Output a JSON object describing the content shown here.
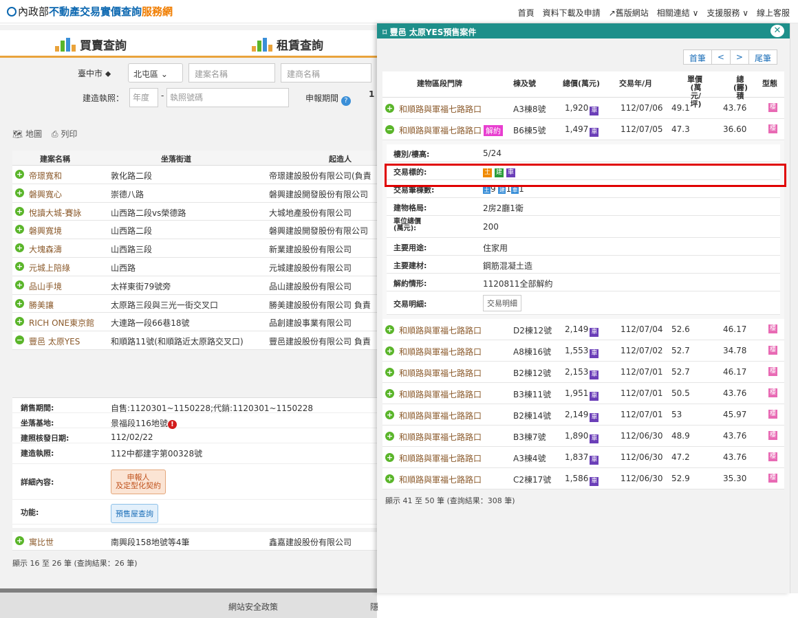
{
  "header": {
    "gov": "內政部",
    "title": "不動產交易實價查詢",
    "service": "服務網",
    "nav": [
      "首頁",
      "資料下載及申請",
      "舊版網站",
      "相關連結 ∨",
      "支援服務 ∨",
      "線上客服"
    ]
  },
  "tabs": {
    "buy": "買賣查詢",
    "rent": "租賃查詢"
  },
  "form": {
    "city": "臺中市 ⬥",
    "district": "北屯區",
    "district_caret": "⌄",
    "case_ph": "建案名稱",
    "builder_ph": "建商名稱",
    "permit_label": "建造執照：",
    "year_ph": "年度",
    "dash": "-",
    "permit_ph": "執照號碼",
    "period_label": "申報期間",
    "period_value": "1"
  },
  "tools": {
    "map": "地圖",
    "print": "列印"
  },
  "left_table": {
    "headers": [
      "建案名稱",
      "坐落街道",
      "起造人"
    ],
    "rows": [
      {
        "name": "帝璟寬和",
        "street": "敦化路二段",
        "owner": "帝璟建設股份有限公司(負責"
      },
      {
        "name": "磐興寬心",
        "street": "崇德八路",
        "owner": "磐興建設開發股份有限公司"
      },
      {
        "name": "悅讀大城-賽詠",
        "street": "山西路二段vs榮德路",
        "owner": "大城地產股份有限公司"
      },
      {
        "name": "磐興寬境",
        "street": "山西路二段",
        "owner": "磐興建設開發股份有限公司"
      },
      {
        "name": "大塊森濤",
        "street": "山西路三段",
        "owner": "新業建設股份有限公司"
      },
      {
        "name": "元城上陪綠",
        "street": "山西路",
        "owner": "元城建設股份有限公司"
      },
      {
        "name": "品山手境",
        "street": "太祥東街79號旁",
        "owner": "品山建設股份有限公司"
      },
      {
        "name": "勝美讓",
        "street": "太原路三段與三光一街交叉口",
        "owner": "勝美建設股份有限公司 負責"
      },
      {
        "name": "RICH ONE東京館",
        "street": "大連路一段66巷18號",
        "owner": "品創建設事業有限公司"
      },
      {
        "name": "豐邑 太原YES",
        "street": "和順路11號(和順路近太原路交叉口)",
        "owner": "豐邑建設股份有限公司 負責"
      }
    ],
    "after_row": {
      "name": "寓比世",
      "street": "南興段158地號等4筆",
      "owner": "鑫嘉建設股份有限公司"
    }
  },
  "left_detail": {
    "sales_k": "銷售期間:",
    "sales_v": "自售:1120301~1150228;代銷:1120301~1150228",
    "base_k": "坐落基地:",
    "base_v": "景福段116地號",
    "date_k": "建照核發日期:",
    "date_v": "112/02/22",
    "permit_k": "建造執照:",
    "permit_v": "112中都建字第00328號",
    "detail_k": "詳細內容:",
    "detail_btn1": "申報人",
    "detail_btn2": "及定型化契約",
    "func_k": "功能:",
    "func_btn": "預售屋查詢"
  },
  "left_footer": "顯示 16 至 26 筆 (查詢結果：26 筆)",
  "page_footer": {
    "policy": "網站安全政策",
    "next": "隱"
  },
  "panel": {
    "title": "豐邑 太原YES預售案件",
    "pager": [
      "首筆",
      "<",
      ">",
      "尾筆"
    ],
    "headers": {
      "addr": "建物區段門牌",
      "bld": "棟及號",
      "price": "總價(萬元)",
      "date": "交易年/月",
      "unit": "單價",
      "unit2": "(萬元/坪)",
      "area": "總面積",
      "area2": "(坪)",
      "type": "型態"
    },
    "rows_top": [
      {
        "addr": "和順路與軍福七路路口",
        "bld": "A3棟8號",
        "price": "1,920",
        "date": "112/07/06",
        "unit": "49.1",
        "area": "43.76"
      }
    ],
    "selected": {
      "addr": "和順路與軍福七路路口",
      "cancel": "解約",
      "bld": "B6棟5號",
      "price": "1,497",
      "date": "112/07/05",
      "unit": "47.3",
      "area": "36.60"
    },
    "detail": {
      "floor_k": "樓別/樓高:",
      "floor_v": "5/24",
      "target_k": "交易標的:",
      "t1": "土",
      "t2": "建",
      "t3": "車",
      "count_k": "交易筆棟數:",
      "c1": "土",
      "c1v": "9",
      "c2": "建",
      "c2v": "1",
      "c3": "車",
      "c3v": "1",
      "layout_k": "建物格局:",
      "layout_v": "2房2廳1衛",
      "park_k1": "車位總價",
      "park_k2": "(萬元):",
      "park_v": "200",
      "use_k": "主要用途:",
      "use_v": "住家用",
      "mat_k": "主要建材:",
      "mat_v": "鋼筋混凝土造",
      "cancel_k": "解約情形:",
      "cancel_v": "1120811全部解約",
      "trade_k": "交易明細:",
      "trade_btn": "交易明細"
    },
    "rows": [
      {
        "addr": "和順路與軍福七路路口",
        "bld": "D2棟12號",
        "price": "2,149",
        "date": "112/07/04",
        "unit": "52.6",
        "area": "46.17"
      },
      {
        "addr": "和順路與軍福七路路口",
        "bld": "A8棟16號",
        "price": "1,553",
        "date": "112/07/02",
        "unit": "52.7",
        "area": "34.78"
      },
      {
        "addr": "和順路與軍福七路路口",
        "bld": "B2棟12號",
        "price": "2,153",
        "date": "112/07/01",
        "unit": "52.7",
        "area": "46.17"
      },
      {
        "addr": "和順路與軍福七路路口",
        "bld": "B3棟11號",
        "price": "1,951",
        "date": "112/07/01",
        "unit": "50.5",
        "area": "43.76"
      },
      {
        "addr": "和順路與軍福七路路口",
        "bld": "B2棟14號",
        "price": "2,149",
        "date": "112/07/01",
        "unit": "53",
        "area": "45.97"
      },
      {
        "addr": "和順路與軍福七路路口",
        "bld": "B3棟7號",
        "price": "1,890",
        "date": "112/06/30",
        "unit": "48.9",
        "area": "43.76"
      },
      {
        "addr": "和順路與軍福七路路口",
        "bld": "A3棟4號",
        "price": "1,837",
        "date": "112/06/30",
        "unit": "47.2",
        "area": "43.76"
      },
      {
        "addr": "和順路與軍福七路路口",
        "bld": "C2棟17號",
        "price": "1,586",
        "date": "112/06/30",
        "unit": "52.9",
        "area": "35.30"
      }
    ],
    "car_glyph": "車",
    "type_glyph": "樓",
    "footer": "顯示 41 至 50 筆 (查詢結果：308 筆)"
  },
  "colors": {
    "accent": "#e9a33b",
    "teal": "#1e8f8a",
    "brand": "#0b67b0",
    "highlight": "#e00000"
  }
}
